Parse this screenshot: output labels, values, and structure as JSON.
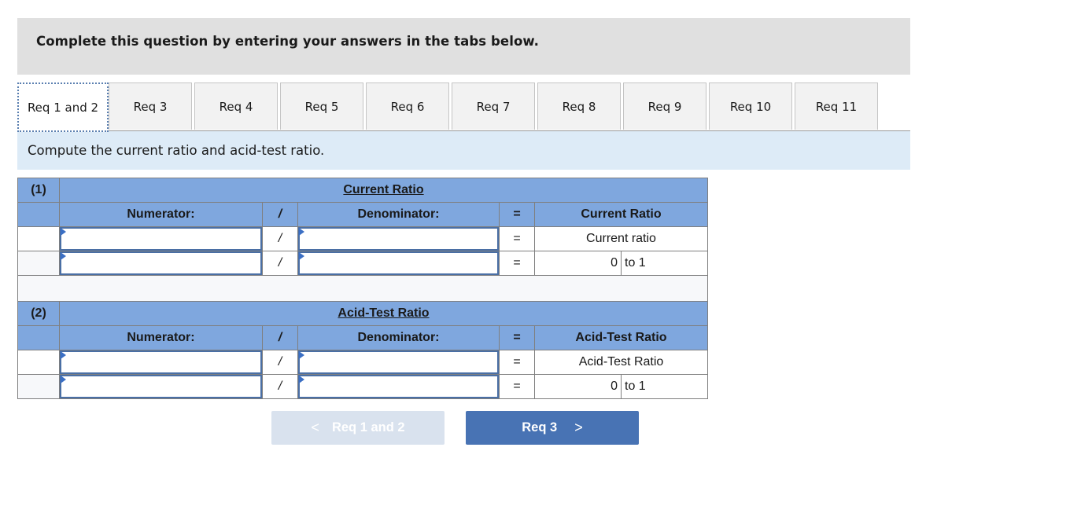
{
  "instruction": "Complete this question by entering your answers in the tabs below.",
  "tabs": [
    {
      "label": "Req 1 and 2",
      "active": true
    },
    {
      "label": "Req 3"
    },
    {
      "label": "Req 4"
    },
    {
      "label": "Req 5"
    },
    {
      "label": "Req 6"
    },
    {
      "label": "Req 7"
    },
    {
      "label": "Req 8"
    },
    {
      "label": "Req 9"
    },
    {
      "label": "Req 10"
    },
    {
      "label": "Req 11"
    }
  ],
  "prompt": "Compute the current ratio and acid-test ratio.",
  "sections": [
    {
      "number": "(1)",
      "title": "Current Ratio",
      "numerator_label": "Numerator:",
      "divide_symbol": "/",
      "denominator_label": "Denominator:",
      "equals_symbol": "=",
      "result_header": "Current Ratio",
      "rows": [
        {
          "numerator": "",
          "denominator": "",
          "result": "Current ratio"
        },
        {
          "numerator": "",
          "denominator": "",
          "result_value": "0",
          "result_suffix": "to 1"
        }
      ]
    },
    {
      "number": "(2)",
      "title": "Acid-Test Ratio",
      "numerator_label": "Numerator:",
      "divide_symbol": "/",
      "denominator_label": "Denominator:",
      "equals_symbol": "=",
      "result_header": "Acid-Test Ratio",
      "rows": [
        {
          "numerator": "",
          "denominator": "",
          "result": "Acid-Test Ratio"
        },
        {
          "numerator": "",
          "denominator": "",
          "result_value": "0",
          "result_suffix": "to 1"
        }
      ]
    }
  ],
  "nav": {
    "prev_label": "Req 1 and 2",
    "prev_icon": "chevron-left-icon",
    "prev_chevron": "<",
    "next_label": "Req 3",
    "next_icon": "chevron-right-icon",
    "next_chevron": ">"
  },
  "colors": {
    "header_blue": "#7fa7de",
    "prompt_bg": "#ddebf7",
    "instruction_bg": "#e0e0e0",
    "next_button": "#4873b4",
    "prev_button_disabled": "#d9e2ee"
  }
}
